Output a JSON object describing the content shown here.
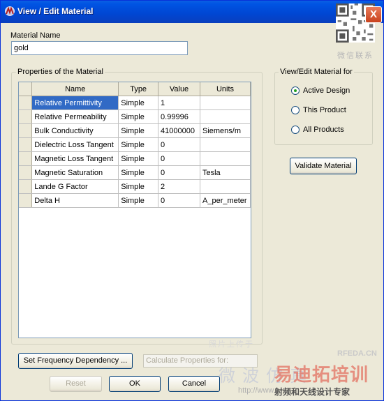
{
  "window": {
    "title": "View / Edit Material",
    "close_glyph": "X"
  },
  "watermark_qr": {
    "caption": "微信联系"
  },
  "material_name": {
    "label": "Material Name",
    "value": "gold"
  },
  "properties_group": {
    "label": "Properties of the Material",
    "columns": [
      "Name",
      "Type",
      "Value",
      "Units"
    ],
    "rows": [
      {
        "name": "Relative Permittivity",
        "type": "Simple",
        "value": "1",
        "units": ""
      },
      {
        "name": "Relative Permeability",
        "type": "Simple",
        "value": "0.99996",
        "units": ""
      },
      {
        "name": "Bulk Conductivity",
        "type": "Simple",
        "value": "41000000",
        "units": "Siemens/m"
      },
      {
        "name": "Dielectric Loss Tangent",
        "type": "Simple",
        "value": "0",
        "units": ""
      },
      {
        "name": "Magnetic Loss Tangent",
        "type": "Simple",
        "value": "0",
        "units": ""
      },
      {
        "name": "Magnetic Saturation",
        "type": "Simple",
        "value": "0",
        "units": "Tesla"
      },
      {
        "name": "Lande G Factor",
        "type": "Simple",
        "value": "2",
        "units": ""
      },
      {
        "name": "Delta H",
        "type": "Simple",
        "value": "0",
        "units": "A_per_meter"
      }
    ],
    "selected_row": 0
  },
  "view_for_group": {
    "label": "View/Edit Material for",
    "options": [
      "Active Design",
      "This Product",
      "All Products"
    ],
    "selected": "Active Design"
  },
  "buttons": {
    "validate": "Validate Material",
    "set_frequency": "Set Frequency Dependency ...",
    "calculate": "Calculate Properties for:",
    "reset": "Reset",
    "ok": "OK",
    "cancel": "Cancel"
  },
  "watermarks": {
    "upload_note": "照片上传于",
    "site": "RFEDA.CN",
    "brand_grey": "微波仿真",
    "brand_red": "易迪拓培训",
    "url": "http://www.",
    "slogan": "射频和天线设计专家"
  },
  "colors": {
    "title_bar": "#0054e3",
    "selection": "#316ac5",
    "dialog_bg": "#ece9d8",
    "close_button": "#d5553a"
  }
}
